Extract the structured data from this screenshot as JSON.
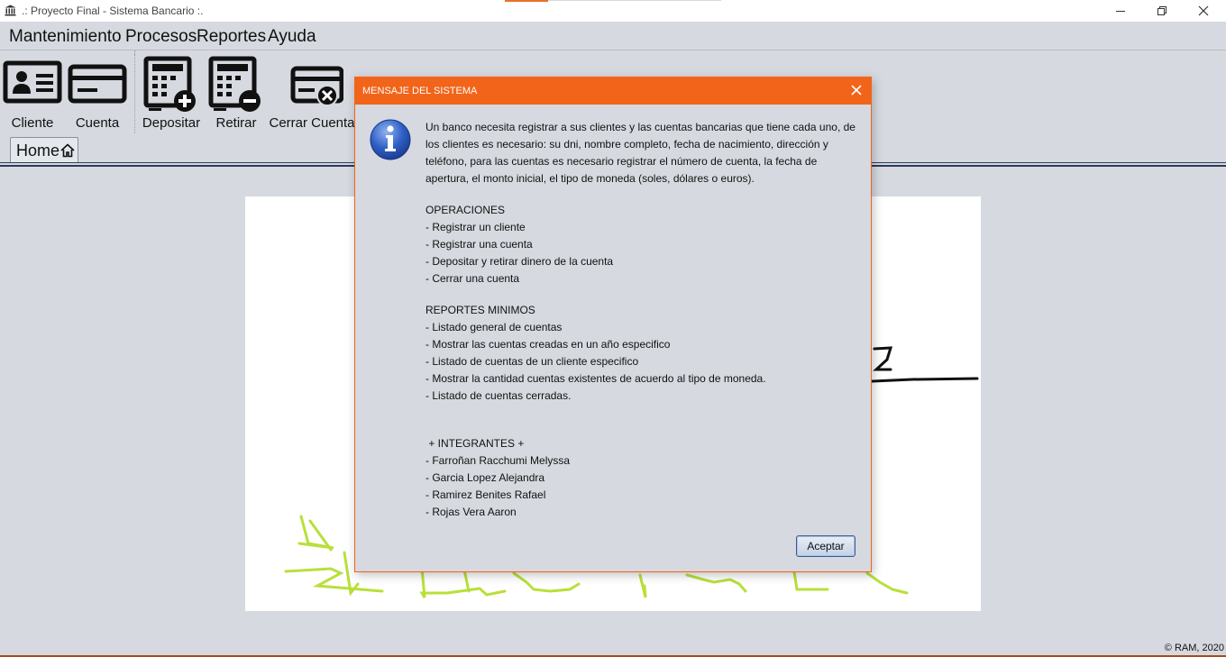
{
  "window": {
    "title": ".: Proyecto Final - Sistema Bancario :."
  },
  "menu": [
    "Mantenimiento",
    "Procesos",
    "Reportes",
    "Ayuda"
  ],
  "toolbar": {
    "cliente": "Cliente",
    "cuenta": "Cuenta",
    "depositar": "Depositar",
    "retirar": "Retirar",
    "cerrar": "Cerrar Cuenta"
  },
  "tabs": [
    {
      "label": "Home",
      "icon": "home-icon"
    }
  ],
  "footer": "© RAM, 2020",
  "colors": {
    "accent": "#f26419",
    "background": "#d6d9df",
    "doodle": "#b8e03a"
  },
  "dialog": {
    "title": "MENSAJE DEL SISTEMA",
    "icon": "info-icon",
    "intro": "Un banco necesita registrar a sus clientes y las cuentas bancarias que tiene cada uno, de los clientes es necesario: su dni, nombre completo, fecha de nacimiento, dirección y teléfono, para las cuentas es necesario registrar el número de cuenta, la fecha de apertura, el monto inicial, el tipo de moneda (soles, dólares o euros).",
    "operaciones_title": "OPERACIONES",
    "operaciones": [
      "- Registrar un cliente",
      "- Registrar una cuenta",
      "- Depositar y retirar dinero de la cuenta",
      "- Cerrar una cuenta"
    ],
    "reportes_title": "REPORTES MINIMOS",
    "reportes": [
      "- Listado general de cuentas",
      "- Mostrar las cuentas creadas en un año especifico",
      "- Listado de cuentas de un cliente especifico",
      "- Mostrar la cantidad cuentas existentes de acuerdo al tipo de moneda.",
      "- Listado de cuentas cerradas."
    ],
    "integrantes_title": " + INTEGRANTES +",
    "integrantes": [
      "- Farroñan Racchumi Melyssa",
      "- Garcia Lopez Alejandra",
      "- Ramirez Benites Rafael",
      "- Rojas Vera Aaron"
    ],
    "accept": "Aceptar"
  }
}
